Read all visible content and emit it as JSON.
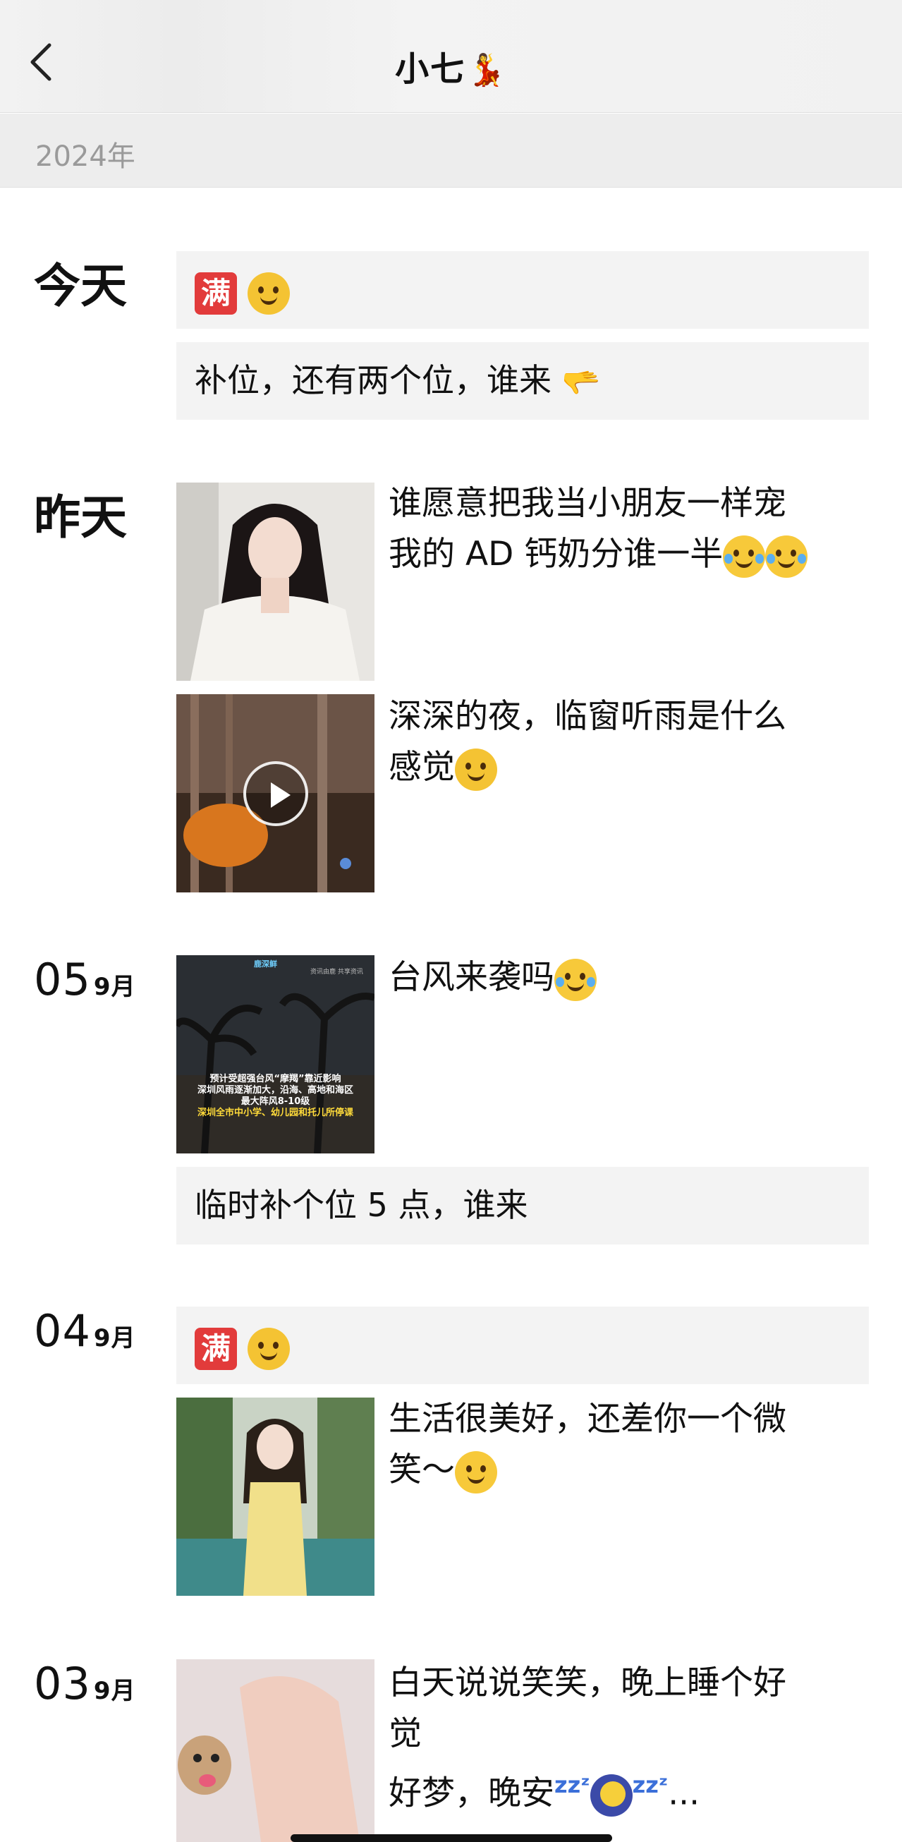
{
  "header": {
    "title": "小七",
    "title_emoji": "💃"
  },
  "year": "2024年",
  "groups": [
    {
      "date_label": "今天",
      "cards": [
        {
          "text": ""
        },
        {
          "text": "补位，还有两个位，谁来"
        }
      ]
    },
    {
      "date_label": "昨天",
      "posts": [
        {
          "line1": "谁愿意把我当小朋友一样宠",
          "line2": "我的 AD 钙奶分谁一半"
        },
        {
          "line1": "深深的夜，临窗听雨是什么",
          "line2": "感觉"
        }
      ]
    },
    {
      "day": "05",
      "month": "9月",
      "posts": [
        {
          "line1": "台风来袭吗"
        }
      ],
      "thumb_text": {
        "brand": "鹿深鲜",
        "small": "资讯由鹿 共享资讯",
        "l1": "预计受超强台风“摩羯”靠近影响",
        "l2": "深圳风雨逐渐加大，沿海、高地和海区",
        "l3": "最大阵风8-10级",
        "l4": "深圳全市中小学、幼儿园和托儿所停课"
      },
      "cards": [
        {
          "text": "临时补个位 5 点，谁来"
        }
      ]
    },
    {
      "day": "04",
      "month": "9月",
      "cards": [
        {
          "text": ""
        }
      ],
      "posts": [
        {
          "line1": "生活很美好，还差你一个微",
          "line2": "笑～"
        }
      ]
    },
    {
      "day": "03",
      "month": "9月",
      "posts": [
        {
          "line1": "白天说说笑笑，晚上睡个好",
          "line2": "觉",
          "line3": "好梦，晚安",
          "line3_tail": "..."
        }
      ]
    }
  ],
  "badge": "满",
  "icons": [
    "back-chevron-icon",
    "play-icon"
  ]
}
